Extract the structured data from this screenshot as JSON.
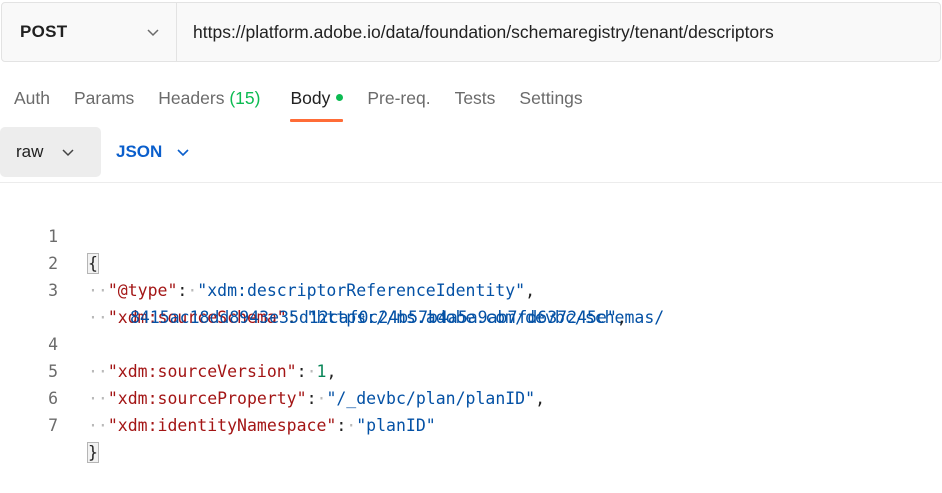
{
  "request": {
    "method": "POST",
    "url": "https://platform.adobe.io/data/foundation/schemaregistry/tenant/descriptors"
  },
  "tabs": {
    "params": "Params",
    "auth": "Auth",
    "headers": "Headers",
    "headers_count": "(15)",
    "body": "Body",
    "prereq": "Pre-req.",
    "tests": "Tests",
    "settings": "Settings"
  },
  "body_options": {
    "mode": "raw",
    "language": "JSON"
  },
  "editor": {
    "line_numbers": [
      "1",
      "2",
      "3",
      "4",
      "5",
      "6",
      "7"
    ],
    "open_brace": "{",
    "close_brace": "}",
    "entries": [
      {
        "key": "\"@type\"",
        "value": "\"xdm:descriptorReferenceIdentity\"",
        "sep": ","
      },
      {
        "key": "\"xdm:sourceSchema\"",
        "value": "\"https://ns.adobe.com/devbc/schemas/",
        "value_cont": "8415ac18dd8943e35d12caf0c24b57b4a5a9ab7fd637245e\"",
        "sep": ","
      },
      {
        "key": "\"xdm:sourceVersion\"",
        "value": "1",
        "sep": ","
      },
      {
        "key": "\"xdm:sourceProperty\"",
        "value": "\"/_devbc/plan/planID\"",
        "sep": ","
      },
      {
        "key": "\"xdm:identityNamespace\"",
        "value": "\"planID\"",
        "sep": ""
      }
    ]
  },
  "colors": {
    "accent_tab": "#ff6c37",
    "status_green": "#0cbb52",
    "json_blue": "#0b5fcc",
    "key_red": "#a31515",
    "string_blue": "#0451a5",
    "number_green": "#098658"
  }
}
